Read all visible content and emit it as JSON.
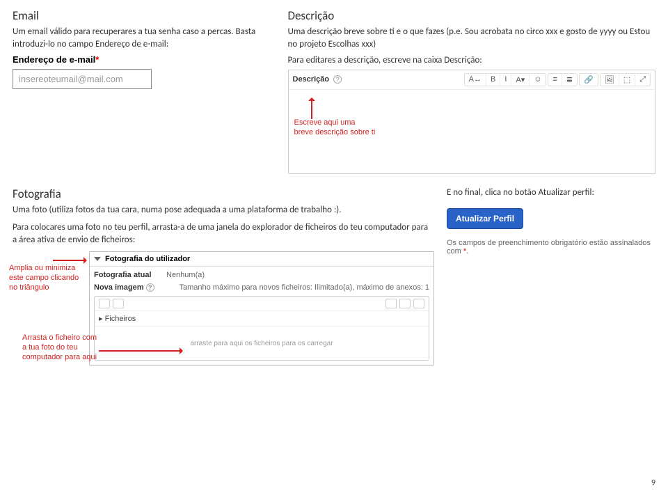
{
  "left": {
    "heading": "Email",
    "p1": "Um email válido para recuperares a tua senha caso a percas. Basta introduzi-lo no campo Endereço de e-mail:",
    "label": "Endereço de e-mail",
    "value": "insereoteumail@mail.com"
  },
  "right": {
    "heading": "Descrição",
    "p1": "Uma descrição breve sobre ti e o que fazes (p.e. Sou acrobata no circo xxx e gosto de yyyy ou Estou no projeto Escolhas xxx)",
    "p2": "Para editares a descrição, escreve na caixa Descrição:",
    "editorLabel": "Descrição",
    "tcall": "Escreve aqui uma\nbreve descrição sobre ti"
  },
  "photo": {
    "heading": "Fotografia",
    "p1": "Uma foto (utiliza fotos da tua cara, numa pose adequada a uma plataforma de trabalho :).",
    "p2": "Para colocares uma foto no teu perfil, arrasta-a de uma janela do explorador de ficheiros do teu computador para a área ativa de envio de ficheiros:",
    "panelTitle": "Fotografia do utilizador",
    "row1l": "Fotografia atual",
    "row1r": "Nenhum(a)",
    "row2l": "Nova imagem",
    "row2r": "Tamanho máximo para novos ficheiros: Ilimitado(a), máximo de anexos: 1",
    "files": "Ficheiros",
    "drop": "arraste para aqui os ficheiros para os carregar",
    "call1": "Amplia ou minimiza este campo clicando no triângulo",
    "call2": "Arrasta o ficheiro com a tua foto do teu computador para aqui"
  },
  "side": {
    "p1": "E no final, clica no botão Atualizar perfil:",
    "btn": "Atualizar Perfil",
    "note": "Os campos de preenchimento obrigatório estão assinalados com ",
    "ast": "*"
  },
  "tb": {
    "a": "A↔",
    "b": "B",
    "c": "I",
    "d": "A▾",
    "e": "☺",
    "f": "≡",
    "g": "≣",
    "h": "🔗",
    "i": "🖼",
    "j": "⬚",
    "k": "⤢"
  },
  "pagenum": "9"
}
